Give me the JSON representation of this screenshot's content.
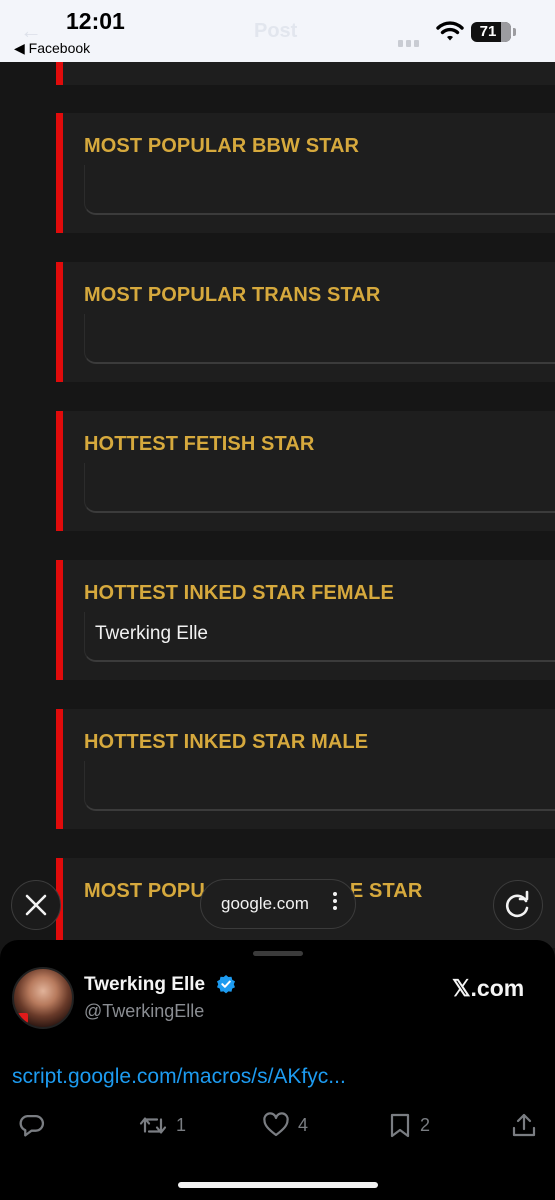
{
  "status_bar": {
    "time": "12:01",
    "back_app": "◀ Facebook",
    "ghost_title": "Post",
    "battery": "71"
  },
  "form": {
    "questions": [
      {
        "label": "MOST POPULAR BBW STAR",
        "answer": ""
      },
      {
        "label": "MOST POPULAR TRANS STAR",
        "answer": ""
      },
      {
        "label": "HOTTEST FETISH STAR",
        "answer": ""
      },
      {
        "label": "HOTTEST INKED STAR FEMALE",
        "answer": "Twerking Elle"
      },
      {
        "label": "HOTTEST INKED STAR MALE",
        "answer": ""
      },
      {
        "label_left": "MOST POPU",
        "label_right": "E STAR"
      }
    ]
  },
  "overlay": {
    "url": "google.com",
    "close_icon": "close-icon",
    "reload_icon": "reload-icon"
  },
  "tweet": {
    "author_name": "Twerking Elle",
    "handle": "@TwerkingElle",
    "site": "𝕏.com",
    "link_text": "script.google.com/macros/s/AKfyc...",
    "replies": "",
    "retweets": "1",
    "likes": "4",
    "bookmarks": "2",
    "accent_color": "#1d9bf0"
  }
}
